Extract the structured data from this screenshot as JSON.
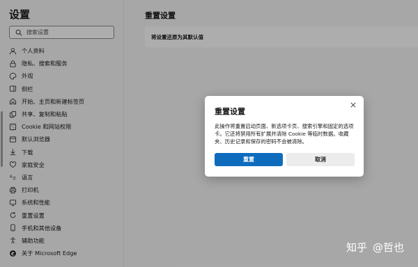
{
  "sidebar": {
    "title": "设置",
    "search_placeholder": "搜索设置",
    "items": [
      {
        "label": "个人资料",
        "icon": "person-icon"
      },
      {
        "label": "隐私、搜索和服务",
        "icon": "lock-icon"
      },
      {
        "label": "外观",
        "icon": "appearance-icon"
      },
      {
        "label": "侧栏",
        "icon": "sidebar-icon"
      },
      {
        "label": "开始、主页和新建标签页",
        "icon": "home-icon"
      },
      {
        "label": "共享、复制和粘贴",
        "icon": "share-icon"
      },
      {
        "label": "Cookie 和网站权限",
        "icon": "cookie-icon"
      },
      {
        "label": "默认浏览器",
        "icon": "browser-icon"
      },
      {
        "label": "下载",
        "icon": "download-icon"
      },
      {
        "label": "家庭安全",
        "icon": "family-icon"
      },
      {
        "label": "语言",
        "icon": "language-icon"
      },
      {
        "label": "打印机",
        "icon": "printer-icon"
      },
      {
        "label": "系统和性能",
        "icon": "system-icon"
      },
      {
        "label": "重置设置",
        "icon": "reset-icon"
      },
      {
        "label": "手机和其他设备",
        "icon": "phone-icon"
      },
      {
        "label": "辅助功能",
        "icon": "accessibility-icon"
      },
      {
        "label": "关于 Microsoft Edge",
        "icon": "edge-icon"
      }
    ]
  },
  "main": {
    "title": "重置设置",
    "card_label": "将设置还原为其默认值"
  },
  "dialog": {
    "title": "重置设置",
    "body": "此操作将重置启动页面、新选项卡页、搜索引擎和固定的选项卡。它还将禁用所有扩展并清除 Cookie 等临时数据。收藏夹、历史记录和保存的密码不会被清除。",
    "confirm_label": "重置",
    "cancel_label": "取消",
    "accent_color": "#0f6cbd"
  },
  "watermark": {
    "site": "知乎",
    "author": "@哲也"
  }
}
